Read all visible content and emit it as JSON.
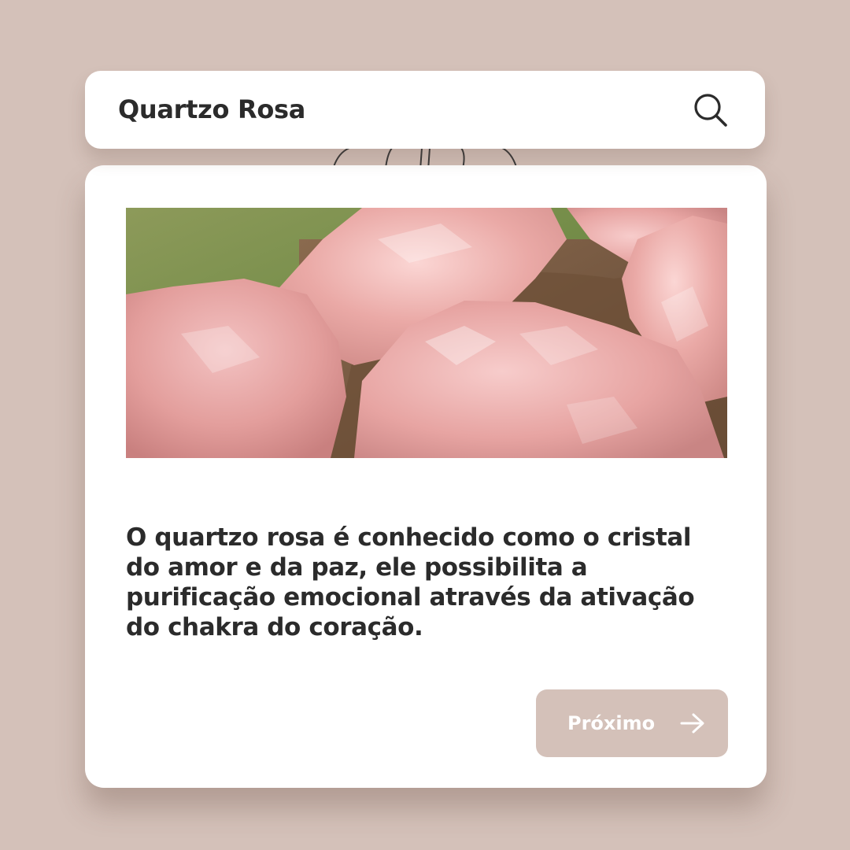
{
  "colors": {
    "background": "#d4c1b9",
    "card": "#ffffff",
    "text": "#2b2b2b",
    "button": "#d4c1b9",
    "button_text": "#ffffff"
  },
  "search": {
    "title": "Quartzo Rosa",
    "icon": "search-icon"
  },
  "card": {
    "image": "rose-quartz-crystals-photo",
    "description": "O quartzo rosa é conhecido como o cristal do amor e da paz, ele possibilita a purificação emocional através da ativação do chakra do coração.",
    "next_button": {
      "label": "Próximo",
      "icon": "arrow-right-icon"
    }
  }
}
